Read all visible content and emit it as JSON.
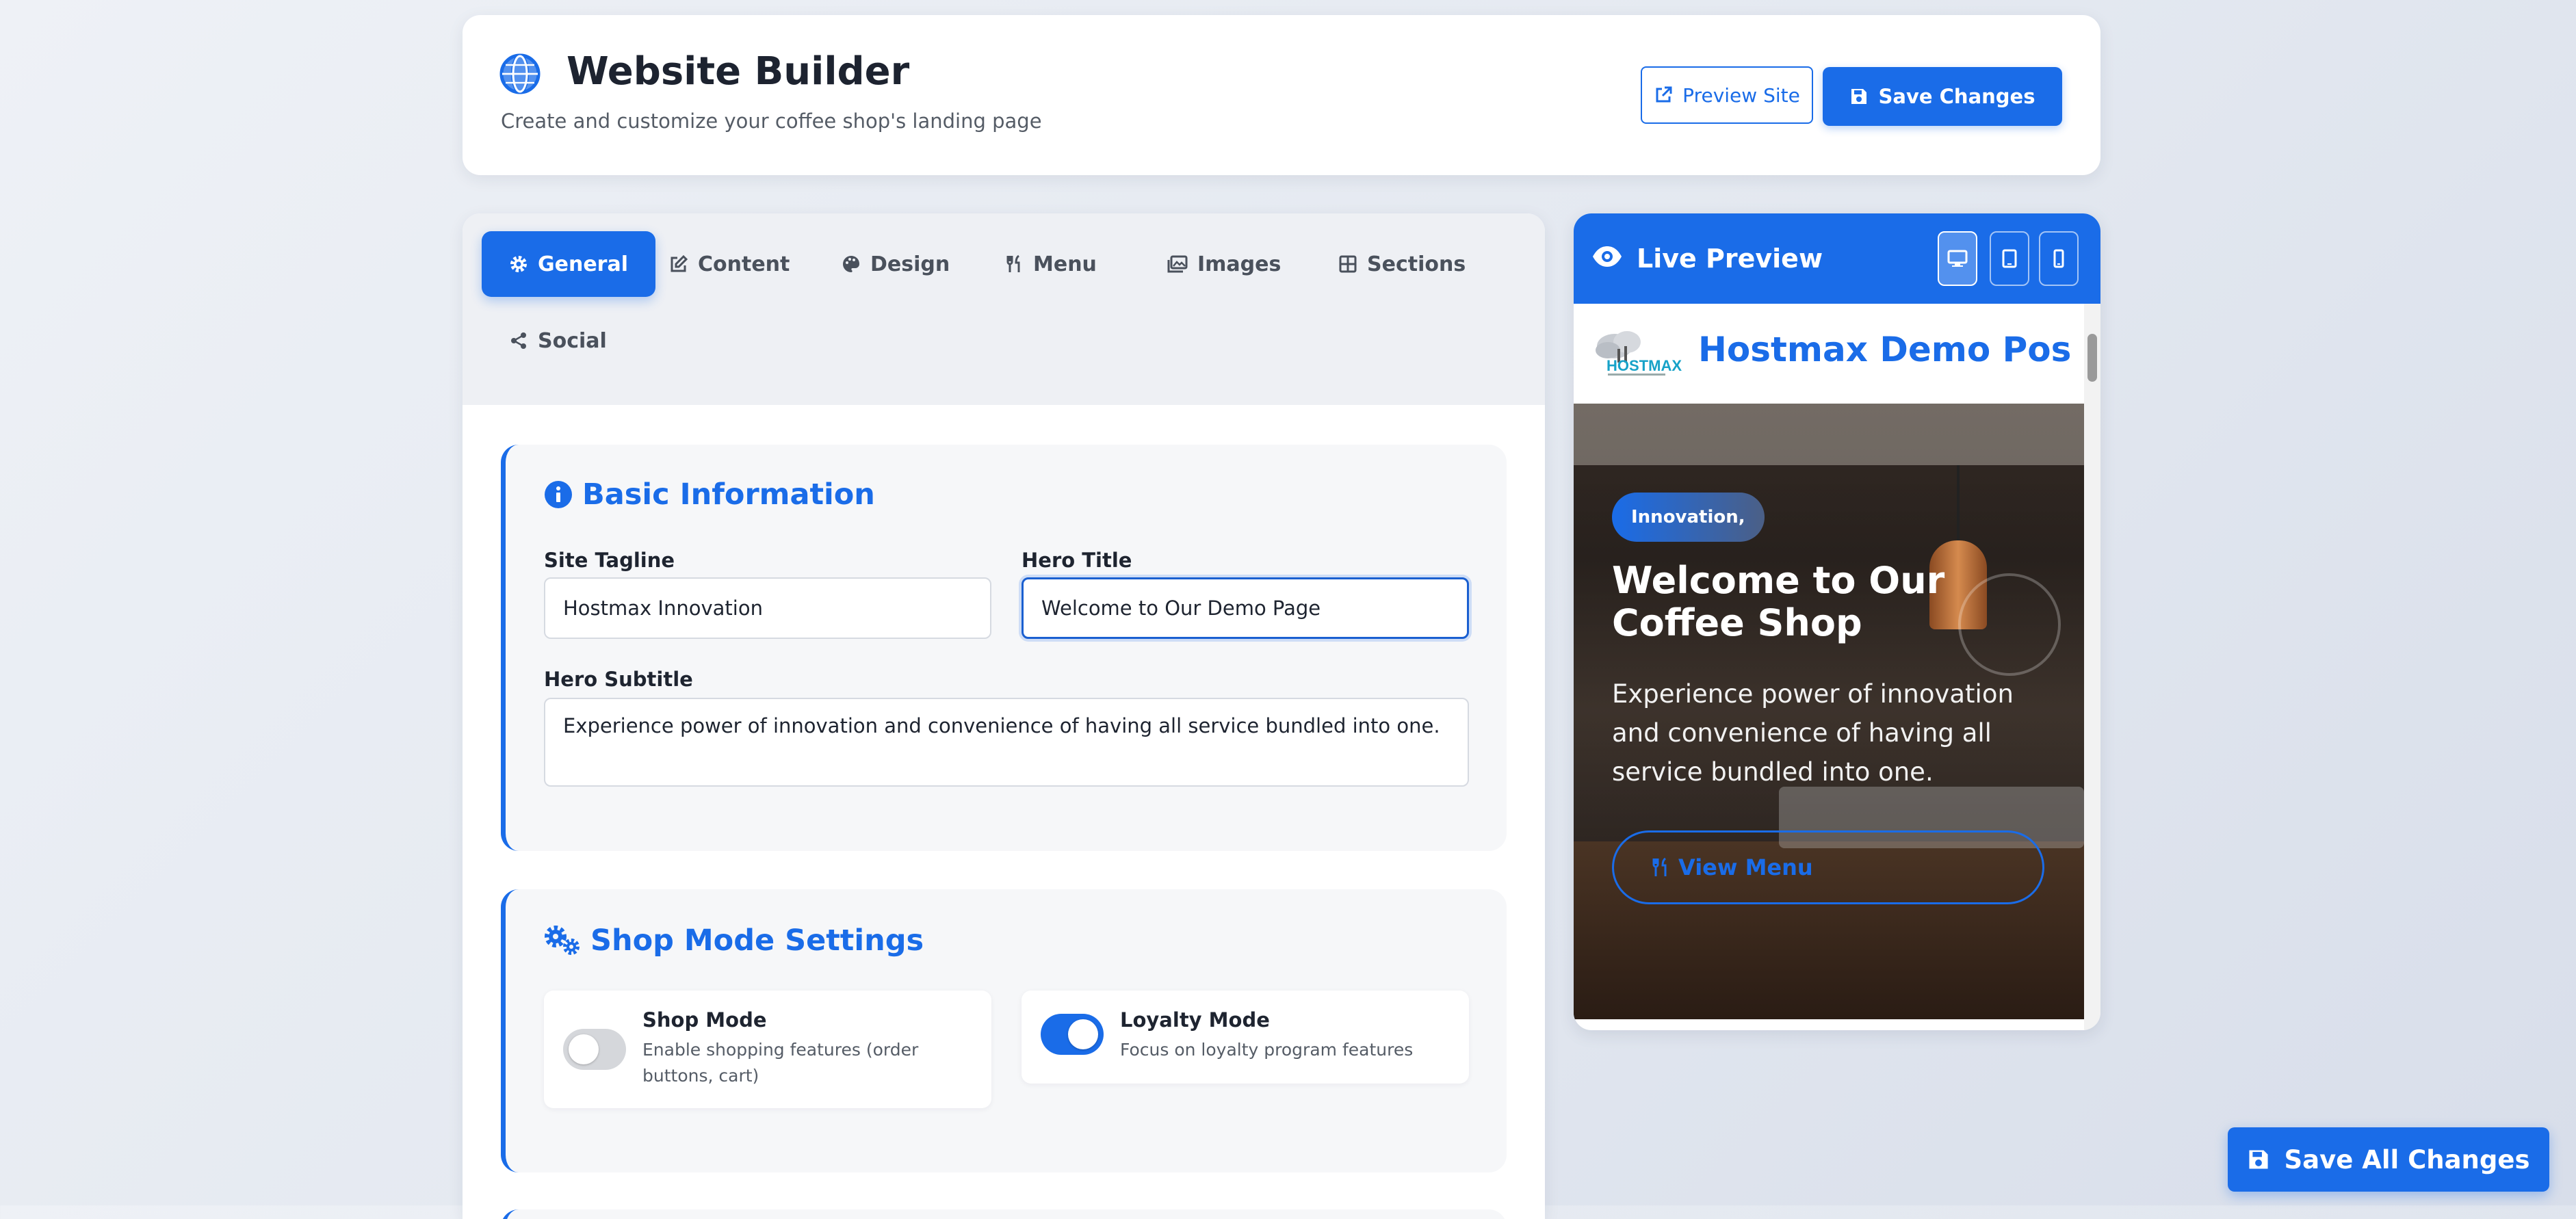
{
  "header": {
    "title": "Website Builder",
    "subtitle": "Create and customize your coffee shop's landing page",
    "preview_label": "Preview Site",
    "save_label": "Save Changes"
  },
  "tabs": [
    {
      "label": "General",
      "icon": "gear-icon",
      "active": true
    },
    {
      "label": "Content",
      "icon": "edit-icon"
    },
    {
      "label": "Design",
      "icon": "palette-icon"
    },
    {
      "label": "Menu",
      "icon": "utensils-icon"
    },
    {
      "label": "Images",
      "icon": "images-icon"
    },
    {
      "label": "Sections",
      "icon": "grid-icon"
    },
    {
      "label": "Social",
      "icon": "share-icon"
    }
  ],
  "basic_info": {
    "title": "Basic Information",
    "tagline_label": "Site Tagline",
    "tagline_value": "Hostmax Innovation",
    "hero_title_label": "Hero Title",
    "hero_title_value": "Welcome to Our Demo Page",
    "hero_subtitle_label": "Hero Subtitle",
    "hero_subtitle_value": "Experience power of innovation and convenience of having all service bundled into one."
  },
  "shop_mode": {
    "title": "Shop Mode Settings",
    "shop": {
      "title": "Shop Mode",
      "desc": "Enable shopping features (order buttons, cart)",
      "on": false
    },
    "loyalty": {
      "title": "Loyalty Mode",
      "desc": "Focus on loyalty program features",
      "on": true
    }
  },
  "preview": {
    "title": "Live Preview",
    "site_name": "Hostmax Demo Pos Su",
    "logo_text": "HOSTMAX",
    "hero_badge": "Innovation,",
    "hero_title": "Welcome to Our Coffee Shop",
    "hero_subtitle": "Experience power of innovation and convenience of having all service bundled into one.",
    "menu_button": "View Menu"
  },
  "save_all_label": "Save All Changes",
  "colors": {
    "accent": "#1a6ce8",
    "text": "#1e2430",
    "muted": "#555c66"
  }
}
